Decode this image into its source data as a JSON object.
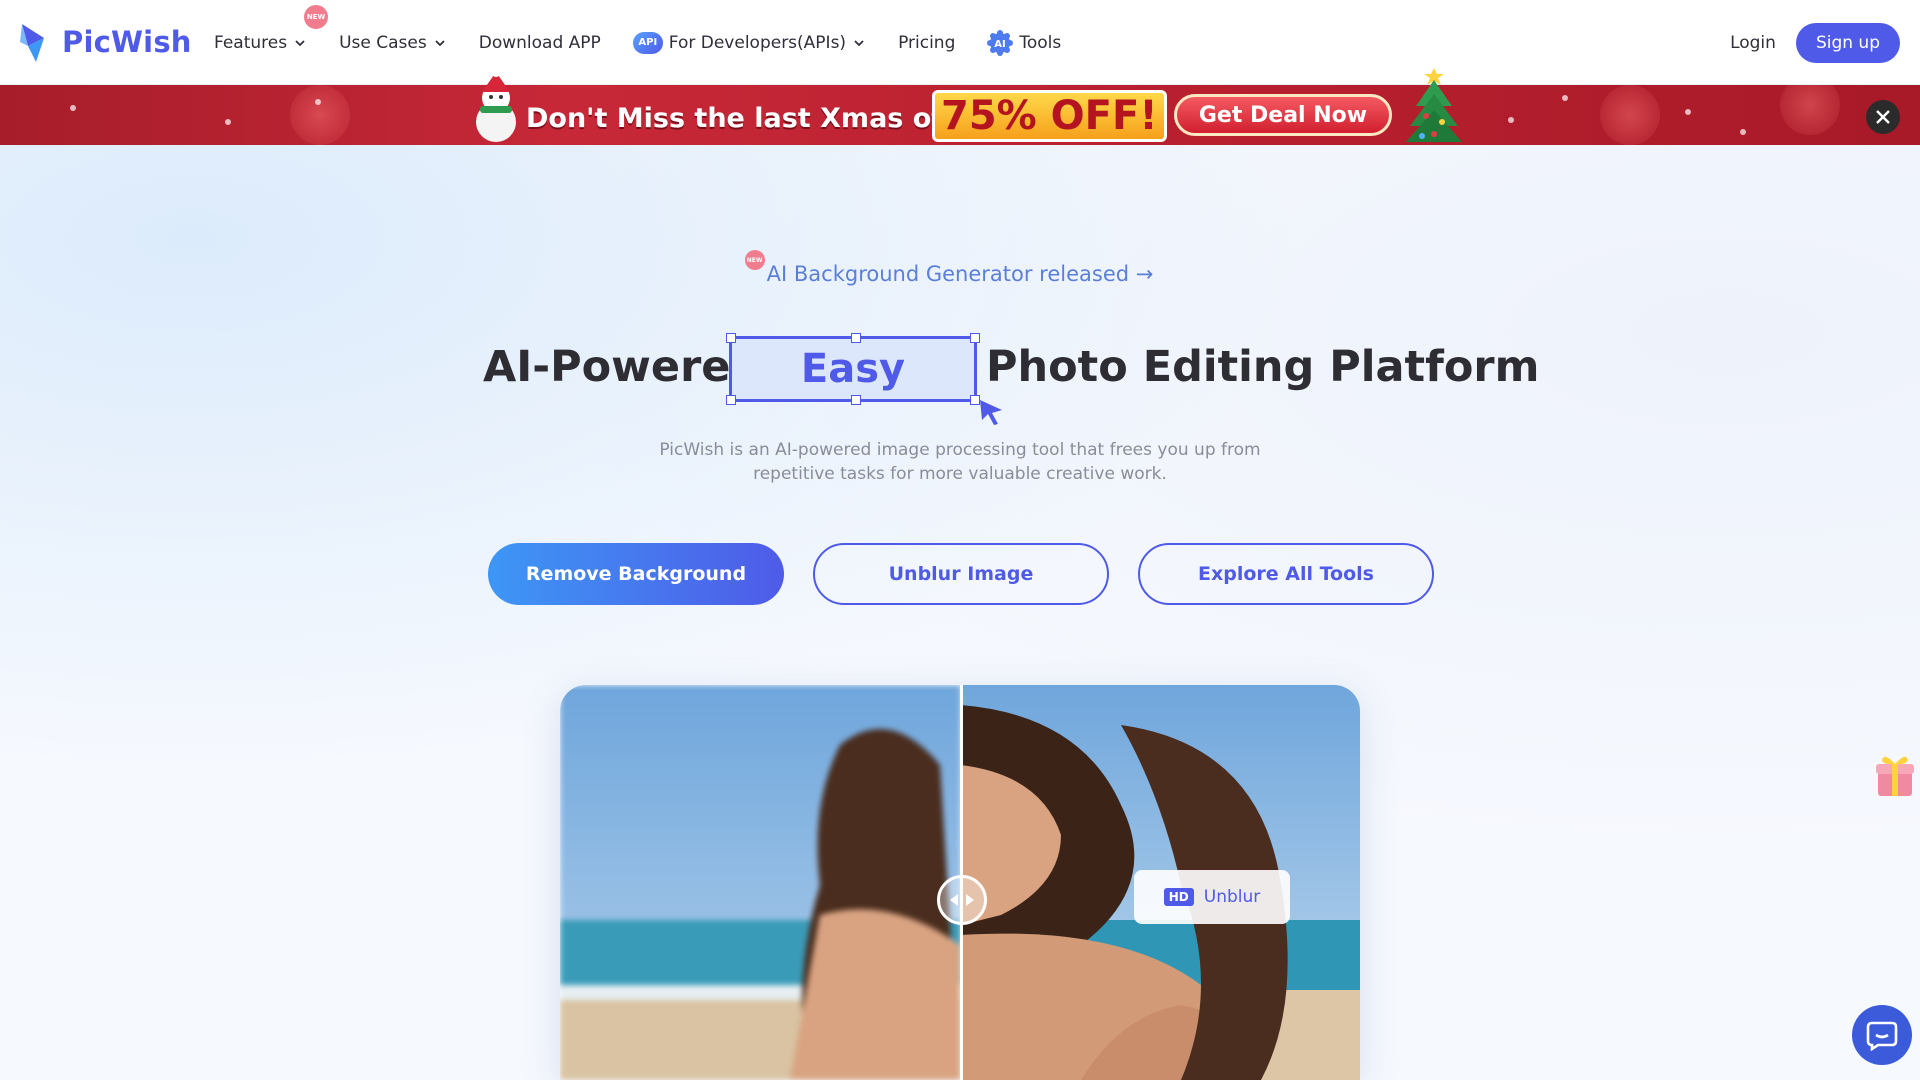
{
  "brand": {
    "name": "PicWish",
    "color": "#4f5be8"
  },
  "nav": {
    "features": "Features",
    "features_badge": "NEW",
    "use_cases": "Use Cases",
    "download": "Download APP",
    "api_badge": "API",
    "developers": "For Developers(APIs)",
    "pricing": "Pricing",
    "tools_badge": "AI",
    "tools": "Tools"
  },
  "auth": {
    "login": "Login",
    "signup": "Sign up"
  },
  "promo": {
    "text": "Don't Miss the last Xmas offer!",
    "discount": "75% OFF!",
    "cta": "Get Deal Now"
  },
  "hero": {
    "announce_badge": "NEW",
    "announce": "AI Background Generator released →",
    "headline_left": "AI-Powered",
    "headline_highlight": "Easy",
    "headline_right": "Photo Editing Platform",
    "subtitle": "PicWish is an AI-powered image processing tool that frees you up from repetitive tasks for more valuable creative work.",
    "buttons": {
      "remove_bg": "Remove Background",
      "unblur": "Unblur Image",
      "explore": "Explore All Tools"
    }
  },
  "compare": {
    "hd_badge": "HD",
    "chip_label": "Unblur"
  }
}
